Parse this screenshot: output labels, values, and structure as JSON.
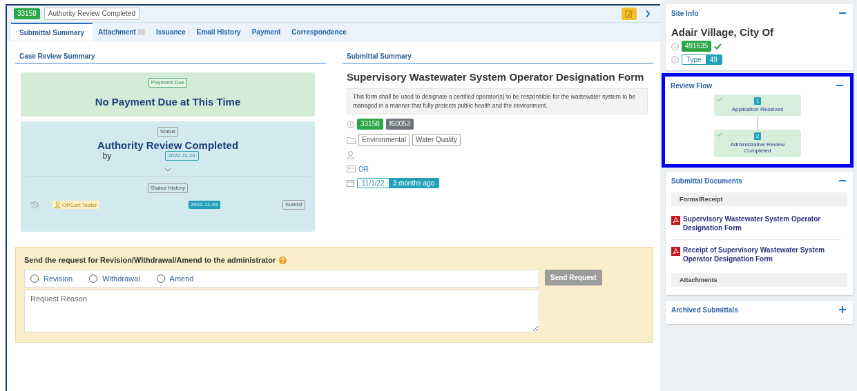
{
  "header": {
    "id_badge": "33158",
    "status_badge": "Authority Review Completed"
  },
  "tabs": [
    {
      "label": "Submittal Summary",
      "selected": true
    },
    {
      "label": "Attachment",
      "selected": false,
      "badge": true
    },
    {
      "label": "Issuance",
      "selected": false
    },
    {
      "label": "Email History",
      "selected": false
    },
    {
      "label": "Payment",
      "selected": false
    },
    {
      "label": "Correspondence",
      "selected": false
    }
  ],
  "case_review": {
    "title": "Case Review Summary",
    "payment": {
      "tag": "Payment Due",
      "message": "No Payment Due at This Time"
    },
    "status": {
      "tag": "Status",
      "title": "Authority Review Completed",
      "by": "by",
      "date": "2022-11-01",
      "history_tag": "Status History",
      "history": [
        {
          "user": "OPCert Tester",
          "date": "2022-11-01",
          "action": "Submit"
        }
      ]
    }
  },
  "submittal_summary": {
    "title": "Submittal Summary",
    "form_title": "Supervisory Wastewater System Operator Designation Form",
    "description": "This form shall be used to designate a certified operator(s) to be responsible for the wastewater system to be managed in a manner that fully protects public health and the environment.",
    "id": "33158",
    "form_id": "f60053",
    "categories": [
      "Environmental",
      "Water Quality"
    ],
    "region": "OR",
    "date": "11/1/22",
    "age": "3 months ago"
  },
  "request": {
    "title": "Send the request for Revision/Withdrawal/Amend to the administrator",
    "options": [
      {
        "label": "Revision",
        "selected": false
      },
      {
        "label": "Withdrawal",
        "selected": false
      },
      {
        "label": "Amend",
        "selected": false
      }
    ],
    "button": "Send Request",
    "reason_placeholder": "Request Reason"
  },
  "sidebar": {
    "site_info": {
      "title": "Site Info",
      "expanded": true,
      "name": "Adair Village, City Of",
      "site_id": "491635",
      "verified": true,
      "type_label": "Type",
      "type_value": "49"
    },
    "review_flow": {
      "title": "Review Flow",
      "expanded": true,
      "highlighted": true,
      "steps": [
        {
          "number": "1",
          "label": "Application Received",
          "done": true
        },
        {
          "number": "2",
          "label": "Administrative Review Completed",
          "done": true
        }
      ]
    },
    "documents": {
      "title": "Submittal Documents",
      "expanded": true,
      "groups": [
        {
          "heading": "Forms/Receipt",
          "files": [
            "Supervisory Wastewater System Operator Designation Form",
            "Receipt of Supervisory Wastewater System Operator Designation Form"
          ]
        },
        {
          "heading": "Attachments"
        }
      ]
    },
    "archived": {
      "title": "Archived Submittals",
      "expanded": false
    }
  }
}
